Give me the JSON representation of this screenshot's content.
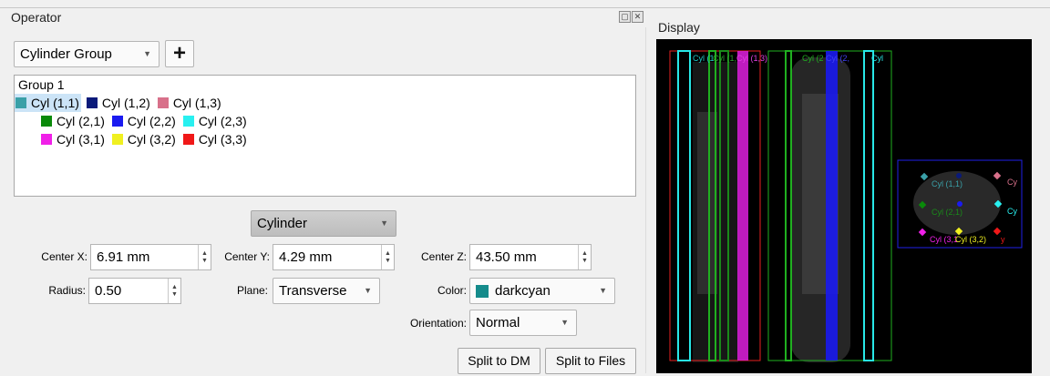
{
  "operator": {
    "title": "Operator",
    "group_select": "Cylinder Group",
    "add_symbol": "+",
    "tree": {
      "group_label": "Group 1",
      "rows": [
        [
          {
            "label": "Cyl (1,1)",
            "color": "#3aa0a8",
            "selected": true
          },
          {
            "label": "Cyl (1,2)",
            "color": "#0a1a7a"
          },
          {
            "label": "Cyl (1,3)",
            "color": "#d8708a"
          }
        ],
        [
          {
            "label": "Cyl (2,1)",
            "color": "#0a8a0a"
          },
          {
            "label": "Cyl (2,2)",
            "color": "#1a1af0"
          },
          {
            "label": "Cyl (2,3)",
            "color": "#28f0f0"
          }
        ],
        [
          {
            "label": "Cyl (3,1)",
            "color": "#f020e8"
          },
          {
            "label": "Cyl (3,2)",
            "color": "#f0f020"
          },
          {
            "label": "Cyl (3,3)",
            "color": "#f01818"
          }
        ]
      ]
    },
    "shape_select": "Cylinder",
    "center_x_label": "Center X:",
    "center_x": "6.91 mm",
    "center_y_label": "Center Y:",
    "center_y": "4.29 mm",
    "center_z_label": "Center Z:",
    "center_z": "43.50 mm",
    "radius_label": "Radius:",
    "radius": "0.50",
    "plane_label": "Plane:",
    "plane": "Transverse",
    "color_label": "Color:",
    "color": "darkcyan",
    "color_hex": "#148b8b",
    "orientation_label": "Orientation:",
    "orientation": "Normal",
    "split_dm": "Split to DM",
    "split_files": "Split to Files"
  },
  "display": {
    "title": "Display",
    "coronal_labels": [
      "Cyl (1",
      "Cyl (1,",
      "Cyl (1,3)"
    ],
    "sagittal_labels": [
      "Cyl (2",
      "Cyl (2,",
      "Cyl"
    ],
    "axial_labels": [
      "Cyl (1,1)",
      "Cy",
      "Cyl (2,1)",
      "Cy",
      "Cyl (3,1",
      "Cyl (3,2)",
      "y"
    ]
  }
}
